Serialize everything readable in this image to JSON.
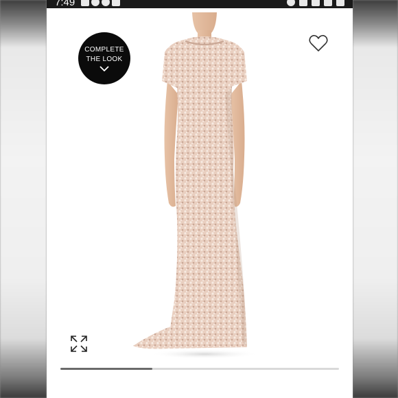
{
  "status_bar": {
    "time": "7:49",
    "left_icons": [
      "photo-icon",
      "chat-icon",
      "messenger-icon",
      "gallery-icon"
    ],
    "right_icons": [
      "face-icon",
      "mute-icon",
      "wifi-icon",
      "signal-icon",
      "battery-icon"
    ]
  },
  "complete_look": {
    "line1": "COMPLETE",
    "line2": "THE LOOK",
    "icon": "chevron-down-icon"
  },
  "favorite_icon": "heart-outline-icon",
  "expand_icon": "expand-arrows-icon",
  "product_image": {
    "subject": "blush sequin beaded short-sleeve gown",
    "colors": {
      "gown": "#e9cfc0",
      "sequins": "#f7ebe2",
      "shadow": "#b89684"
    }
  },
  "carousel": {
    "progress": 0.33,
    "track_color": "#d9d9d9",
    "fill_color": "#6a6a6a"
  }
}
